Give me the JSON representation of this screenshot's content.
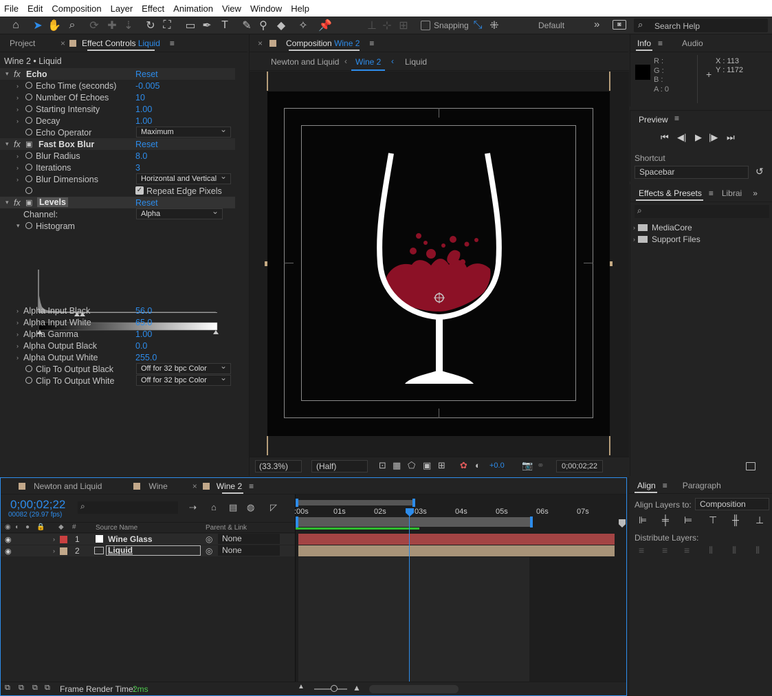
{
  "menu": [
    "File",
    "Edit",
    "Composition",
    "Layer",
    "Effect",
    "Animation",
    "View",
    "Window",
    "Help"
  ],
  "toolbar": {
    "snapping_label": "Snapping",
    "workspace_label": "Default",
    "search_placeholder": "Search Help"
  },
  "left_panel": {
    "tabs": [
      "Project",
      "Effect Controls"
    ],
    "effect_controls_layer": "Liquid",
    "breadcrumb": "Wine 2 • Liquid",
    "effects": [
      {
        "name": "Echo",
        "reset": "Reset",
        "properties": [
          {
            "label": "Echo Time (seconds)",
            "value": "-0.005"
          },
          {
            "label": "Number Of Echoes",
            "value": "10"
          },
          {
            "label": "Starting Intensity",
            "value": "1.00"
          },
          {
            "label": "Decay",
            "value": "1.00"
          },
          {
            "label": "Echo Operator",
            "value": "Maximum",
            "type": "dropdown"
          }
        ]
      },
      {
        "name": "Fast Box Blur",
        "reset": "Reset",
        "properties": [
          {
            "label": "Blur Radius",
            "value": "8.0"
          },
          {
            "label": "Iterations",
            "value": "3"
          },
          {
            "label": "Blur Dimensions",
            "value": "Horizontal and Vertical",
            "type": "dropdown"
          },
          {
            "label": "Repeat Edge Pixels",
            "value": true,
            "type": "checkbox"
          }
        ]
      },
      {
        "name": "Levels",
        "reset": "Reset",
        "channel_label": "Channel:",
        "channel_value": "Alpha",
        "histogram_label": "Histogram",
        "properties": [
          {
            "label": "Alpha Input Black",
            "value": "56.0"
          },
          {
            "label": "Alpha Input White",
            "value": "65.0"
          },
          {
            "label": "Alpha Gamma",
            "value": "1.00"
          },
          {
            "label": "Alpha Output Black",
            "value": "0.0"
          },
          {
            "label": "Alpha Output White",
            "value": "255.0"
          },
          {
            "label": "Clip To Output Black",
            "value": "Off for 32 bpc Color",
            "type": "dropdown"
          },
          {
            "label": "Clip To Output White",
            "value": "Off for 32 bpc Color",
            "type": "dropdown"
          }
        ]
      }
    ]
  },
  "composition_panel": {
    "title": "Composition",
    "comp_name": "Wine 2",
    "nav": [
      "Newton and Liquid",
      "Wine 2",
      "Liquid"
    ],
    "zoom": "(33.3%)",
    "resolution": "(Half)",
    "exposure": "+0.0",
    "timecode": "0;00;02;22",
    "liquid_color": "#8c1126"
  },
  "info_panel": {
    "tabs": [
      "Info",
      "Audio"
    ],
    "r_label": "R :",
    "g_label": "G :",
    "b_label": "B :",
    "a_label": "A : 0",
    "x_label": "X : 113",
    "y_label": "Y : 1172"
  },
  "preview_panel": {
    "title": "Preview",
    "shortcut_label": "Shortcut",
    "shortcut_value": "Spacebar"
  },
  "effects_presets_panel": {
    "tabs": [
      "Effects & Presets",
      "Librai"
    ],
    "folders": [
      "MediaCore",
      "Support Files"
    ]
  },
  "timeline": {
    "tabs": [
      "Newton and Liquid",
      "Wine",
      "Wine 2"
    ],
    "timecode": "0;00;02;22",
    "frames": "00082 (29.97 fps)",
    "col_source": "Source Name",
    "col_parent": "Parent & Link",
    "layers": [
      {
        "num": "1",
        "name": "Wine Glass",
        "parent": "None",
        "label_color": "#c94040",
        "bar_color": "#a34444"
      },
      {
        "num": "2",
        "name": "Liquid",
        "parent": "None",
        "label_color": "#c2a88a",
        "bar_color": "#a89378"
      }
    ],
    "ruler": [
      ":00s",
      "01s",
      "02s",
      "03s",
      "04s",
      "05s",
      "06s",
      "07s"
    ],
    "footer_label": "Frame Render Time:",
    "footer_value": "2ms"
  },
  "align_panel": {
    "tabs": [
      "Align",
      "Paragraph"
    ],
    "align_to_label": "Align Layers to:",
    "align_to_value": "Composition",
    "distribute_label": "Distribute Layers:"
  },
  "colors": {
    "accent": "#2d8ceb",
    "panel_bg": "#232323",
    "header_bg": "#2c2c2c"
  }
}
